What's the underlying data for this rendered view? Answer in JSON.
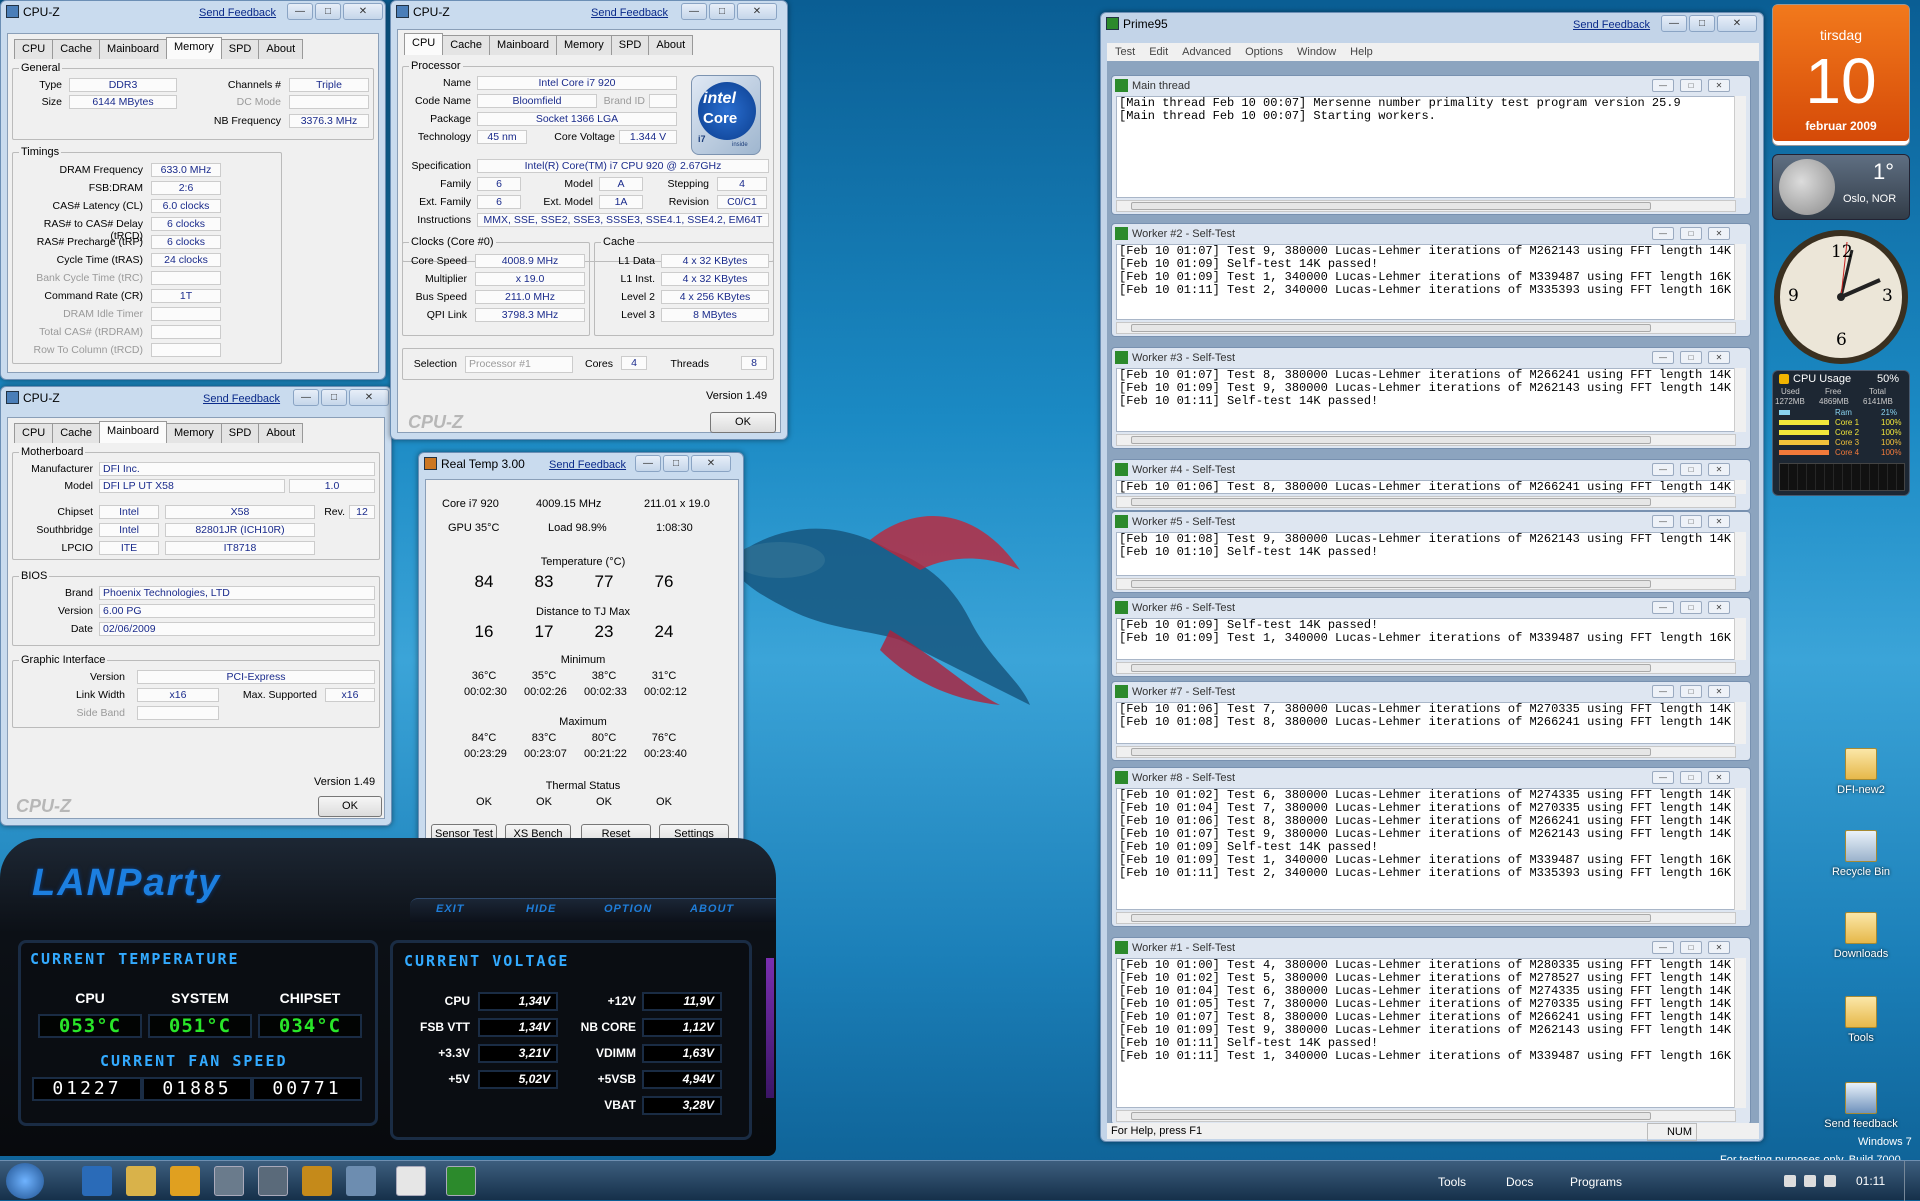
{
  "cpuz_memory": {
    "title": "CPU-Z",
    "feedback": "Send Feedback",
    "tabs": [
      "CPU",
      "Cache",
      "Mainboard",
      "Memory",
      "SPD",
      "About"
    ],
    "general_label": "General",
    "type_label": "Type",
    "type": "DDR3",
    "channels_label": "Channels #",
    "channels": "Triple",
    "size_label": "Size",
    "size": "6144 MBytes",
    "dcmode_label": "DC Mode",
    "nbfreq_label": "NB Frequency",
    "nbfreq": "3376.3 MHz",
    "timings_label": "Timings",
    "timings": [
      {
        "label": "DRAM Frequency",
        "value": "633.0 MHz"
      },
      {
        "label": "FSB:DRAM",
        "value": "2:6"
      },
      {
        "label": "CAS# Latency (CL)",
        "value": "6.0 clocks"
      },
      {
        "label": "RAS# to CAS# Delay (tRCD)",
        "value": "6 clocks"
      },
      {
        "label": "RAS# Precharge (tRP)",
        "value": "6 clocks"
      },
      {
        "label": "Cycle Time (tRAS)",
        "value": "24 clocks"
      },
      {
        "label": "Bank Cycle Time (tRC)",
        "value": ""
      },
      {
        "label": "Command Rate (CR)",
        "value": "1T"
      },
      {
        "label": "DRAM Idle Timer",
        "value": ""
      },
      {
        "label": "Total CAS# (tRDRAM)",
        "value": ""
      },
      {
        "label": "Row To Column (tRCD)",
        "value": ""
      }
    ]
  },
  "cpuz_cpu": {
    "title": "CPU-Z",
    "feedback": "Send Feedback",
    "tabs": [
      "CPU",
      "Cache",
      "Mainboard",
      "Memory",
      "SPD",
      "About"
    ],
    "processor_label": "Processor",
    "name_label": "Name",
    "name": "Intel Core i7 920",
    "codename_label": "Code Name",
    "codename": "Bloomfield",
    "brandid_label": "Brand ID",
    "package_label": "Package",
    "package": "Socket 1366 LGA",
    "tech_label": "Technology",
    "tech": "45 nm",
    "corev_label": "Core Voltage",
    "corev": "1.344 V",
    "spec_label": "Specification",
    "spec": "Intel(R) Core(TM) i7 CPU       920  @ 2.67GHz",
    "family_label": "Family",
    "family": "6",
    "model_label": "Model",
    "model": "A",
    "stepping_label": "Stepping",
    "stepping": "4",
    "extfamily_label": "Ext. Family",
    "extfamily": "6",
    "extmodel_label": "Ext. Model",
    "extmodel": "1A",
    "revision_label": "Revision",
    "revision": "C0/C1",
    "instr_label": "Instructions",
    "instr": "MMX, SSE, SSE2, SSE3, SSSE3, SSE4.1, SSE4.2, EM64T",
    "clocks_label": "Clocks (Core #0)",
    "corespeed_label": "Core Speed",
    "corespeed": "4008.9 MHz",
    "mult_label": "Multiplier",
    "mult": "x 19.0",
    "bus_label": "Bus Speed",
    "bus": "211.0 MHz",
    "qpi_label": "QPI Link",
    "qpi": "3798.3 MHz",
    "cache_label": "Cache",
    "l1d_label": "L1 Data",
    "l1d": "4 x 32 KBytes",
    "l1i_label": "L1 Inst.",
    "l1i": "4 x 32 KBytes",
    "l2_label": "Level 2",
    "l2": "4 x 256 KBytes",
    "l3_label": "Level 3",
    "l3": "8 MBytes",
    "selection_label": "Selection",
    "selection": "Processor #1",
    "cores_label": "Cores",
    "cores": "4",
    "threads_label": "Threads",
    "threads": "8",
    "version": "Version 1.49",
    "ok": "OK",
    "logo": "CPU-Z",
    "intel_logo": {
      "brand": "intel",
      "line": "Core",
      "sub": "i7",
      "inside": "inside"
    }
  },
  "cpuz_mb": {
    "title": "CPU-Z",
    "feedback": "Send Feedback",
    "tabs": [
      "CPU",
      "Cache",
      "Mainboard",
      "Memory",
      "SPD",
      "About"
    ],
    "motherboard_label": "Motherboard",
    "manufacturer_label": "Manufacturer",
    "manufacturer": "DFI Inc.",
    "model_label": "Model",
    "model": "DFI LP UT X58",
    "model_rev": "1.0",
    "chipset_label": "Chipset",
    "chipset_vendor": "Intel",
    "chipset": "X58",
    "rev_label": "Rev.",
    "chipset_rev": "12",
    "southbridge_label": "Southbridge",
    "sb_vendor": "Intel",
    "sb": "82801JR (ICH10R)",
    "lpcio_label": "LPCIO",
    "lpcio_vendor": "ITE",
    "lpcio": "IT8718",
    "bios_label": "BIOS",
    "brand_label": "Brand",
    "brand": "Phoenix Technologies, LTD",
    "version_label": "Version",
    "bios_version": "6.00 PG",
    "date_label": "Date",
    "date": "02/06/2009",
    "graphic_label": "Graphic Interface",
    "gversion_label": "Version",
    "gversion": "PCI-Express",
    "linkwidth_label": "Link Width",
    "linkwidth": "x16",
    "maxsup_label": "Max. Supported",
    "maxsup": "x16",
    "sideband_label": "Side Band",
    "version": "Version 1.49",
    "ok": "OK",
    "logo": "CPU-Z"
  },
  "realtemp": {
    "title": "Real Temp 3.00",
    "feedback": "Send Feedback",
    "cpu": "Core i7 920",
    "freq": "4009.15 MHz",
    "mult": "211.01 x 19.0",
    "gpu": "GPU  35°C",
    "load": "Load  98.9%",
    "time": "1:08:30",
    "temp_label": "Temperature (°C)",
    "temps": [
      "84",
      "83",
      "77",
      "76"
    ],
    "tj_label": "Distance to TJ Max",
    "tj": [
      "16",
      "17",
      "23",
      "24"
    ],
    "min_label": "Minimum",
    "min": [
      "36°C",
      "35°C",
      "38°C",
      "31°C"
    ],
    "min_t": [
      "00:02:30",
      "00:02:26",
      "00:02:33",
      "00:02:12"
    ],
    "max_label": "Maximum",
    "max": [
      "84°C",
      "83°C",
      "80°C",
      "76°C"
    ],
    "max_t": [
      "00:23:29",
      "00:23:07",
      "00:21:22",
      "00:23:40"
    ],
    "thermal_label": "Thermal Status",
    "thermal": [
      "OK",
      "OK",
      "OK",
      "OK"
    ],
    "buttons": [
      "Sensor Test",
      "XS Bench",
      "Reset",
      "Settings"
    ]
  },
  "lanparty": {
    "logo": "LANParty",
    "nav": [
      "EXIT",
      "HIDE",
      "OPTION",
      "ABOUT"
    ],
    "temp_title": "CURRENT TEMPERATURE",
    "temp_labels": [
      "CPU",
      "SYSTEM",
      "CHIPSET"
    ],
    "temps": [
      "053°C",
      "051°C",
      "034°C"
    ],
    "fan_title": "CURRENT FAN SPEED",
    "fans": [
      "01227",
      "01885",
      "00771"
    ],
    "volt_title": "CURRENT VOLTAGE",
    "volt_left": [
      {
        "label": "CPU",
        "value": "1,34V"
      },
      {
        "label": "FSB VTT",
        "value": "1,34V"
      },
      {
        "label": "+3.3V",
        "value": "3,21V"
      },
      {
        "label": "+5V",
        "value": "5,02V"
      }
    ],
    "volt_right": [
      {
        "label": "+12V",
        "value": "11,9V"
      },
      {
        "label": "NB CORE",
        "value": "1,12V"
      },
      {
        "label": "VDIMM",
        "value": "1,63V"
      },
      {
        "label": "+5VSB",
        "value": "4,94V"
      },
      {
        "label": "VBAT",
        "value": "3,28V"
      }
    ]
  },
  "prime95": {
    "title": "Prime95",
    "feedback": "Send Feedback",
    "menu": [
      "Test",
      "Edit",
      "Advanced",
      "Options",
      "Window",
      "Help"
    ],
    "status": "For Help, press F1",
    "num": "NUM",
    "windows": [
      {
        "title": "Main thread",
        "lines": [
          "",
          "",
          "",
          "",
          "",
          "[Main thread Feb 10 00:07] Mersenne number primality test program version 25.9",
          "[Main thread Feb 10 00:07] Starting workers."
        ]
      },
      {
        "title": "Worker #2 - Self-Test",
        "lines": [
          "[Feb 10 01:07] Test 9, 380000 Lucas-Lehmer iterations of M262143 using FFT length 14K.",
          "[Feb 10 01:09] Self-test 14K passed!",
          "[Feb 10 01:09] Test 1, 340000 Lucas-Lehmer iterations of M339487 using FFT length 16K.",
          "[Feb 10 01:11] Test 2, 340000 Lucas-Lehmer iterations of M335393 using FFT length 16K."
        ]
      },
      {
        "title": "Worker #3 - Self-Test",
        "lines": [
          "[Feb 10 01:07] Test 8, 380000 Lucas-Lehmer iterations of M266241 using FFT length 14K.",
          "[Feb 10 01:09] Test 9, 380000 Lucas-Lehmer iterations of M262143 using FFT length 14K.",
          "[Feb 10 01:11] Self-test 14K passed!"
        ]
      },
      {
        "title": "Worker #4 - Self-Test",
        "lines": [
          "[Feb 10 01:06] Test 8, 380000 Lucas-Lehmer iterations of M266241 using FFT length 14K."
        ]
      },
      {
        "title": "Worker #5 - Self-Test",
        "lines": [
          "[Feb 10 01:08] Test 9, 380000 Lucas-Lehmer iterations of M262143 using FFT length 14K.",
          "[Feb 10 01:10] Self-test 14K passed!"
        ]
      },
      {
        "title": "Worker #6 - Self-Test",
        "lines": [
          "[Feb 10 01:09] Self-test 14K passed!",
          "[Feb 10 01:09] Test 1, 340000 Lucas-Lehmer iterations of M339487 using FFT length 16K."
        ]
      },
      {
        "title": "Worker #7 - Self-Test",
        "lines": [
          "[Feb 10 01:06] Test 7, 380000 Lucas-Lehmer iterations of M270335 using FFT length 14K.",
          "[Feb 10 01:08] Test 8, 380000 Lucas-Lehmer iterations of M266241 using FFT length 14K."
        ]
      },
      {
        "title": "Worker #8 - Self-Test",
        "lines": [
          "[Feb 10 01:02] Test 6, 380000 Lucas-Lehmer iterations of M274335 using FFT length 14K.",
          "[Feb 10 01:04] Test 7, 380000 Lucas-Lehmer iterations of M270335 using FFT length 14K.",
          "[Feb 10 01:06] Test 8, 380000 Lucas-Lehmer iterations of M266241 using FFT length 14K.",
          "[Feb 10 01:07] Test 9, 380000 Lucas-Lehmer iterations of M262143 using FFT length 14K.",
          "[Feb 10 01:09] Self-test 14K passed!",
          "[Feb 10 01:09] Test 1, 340000 Lucas-Lehmer iterations of M339487 using FFT length 16K.",
          "[Feb 10 01:11] Test 2, 340000 Lucas-Lehmer iterations of M335393 using FFT length 16K."
        ]
      },
      {
        "title": "Worker #1 - Self-Test",
        "lines": [
          "[Feb 10 01:00] Test 4, 380000 Lucas-Lehmer iterations of M280335 using FFT length 14K.",
          "[Feb 10 01:02] Test 5, 380000 Lucas-Lehmer iterations of M278527 using FFT length 14K.",
          "[Feb 10 01:04] Test 6, 380000 Lucas-Lehmer iterations of M274335 using FFT length 14K.",
          "[Feb 10 01:05] Test 7, 380000 Lucas-Lehmer iterations of M270335 using FFT length 14K.",
          "[Feb 10 01:07] Test 8, 380000 Lucas-Lehmer iterations of M266241 using FFT length 14K.",
          "[Feb 10 01:09] Test 9, 380000 Lucas-Lehmer iterations of M262143 using FFT length 14K.",
          "[Feb 10 01:11] Self-test 14K passed!",
          "[Feb 10 01:11] Test 1, 340000 Lucas-Lehmer iterations of M339487 using FFT length 16K."
        ]
      }
    ]
  },
  "gadgets": {
    "cal_day": "tirsdag",
    "cal_date": "10",
    "cal_month": "februar 2009",
    "weather_temp": "1°",
    "weather_city": "Oslo, NOR",
    "clock_numbers": [
      "12",
      "3",
      "6",
      "9"
    ],
    "cpu_title": "CPU Usage",
    "cpu_pct": "50%",
    "cpu_cols": [
      "Used",
      "Free",
      "Total"
    ],
    "cpu_vals": [
      "1272MB",
      "4869MB",
      "6141MB"
    ],
    "cpu_rows": [
      {
        "label": "Ram",
        "pct": "21%"
      },
      {
        "label": "Core 1",
        "pct": "100%"
      },
      {
        "label": "Core 2",
        "pct": "100%"
      },
      {
        "label": "Core 3",
        "pct": "100%"
      },
      {
        "label": "Core 4",
        "pct": "100%"
      }
    ]
  },
  "desktop": {
    "icons": [
      "DFI-new2",
      "Recycle Bin",
      "Downloads",
      "Tools",
      "Send feedback"
    ],
    "win7": "Windows 7",
    "build": "For testing purposes only. Build 7000"
  },
  "taskbar": {
    "toolbars": [
      "Tools",
      "Docs",
      "Programs"
    ],
    "time": "01:11"
  }
}
